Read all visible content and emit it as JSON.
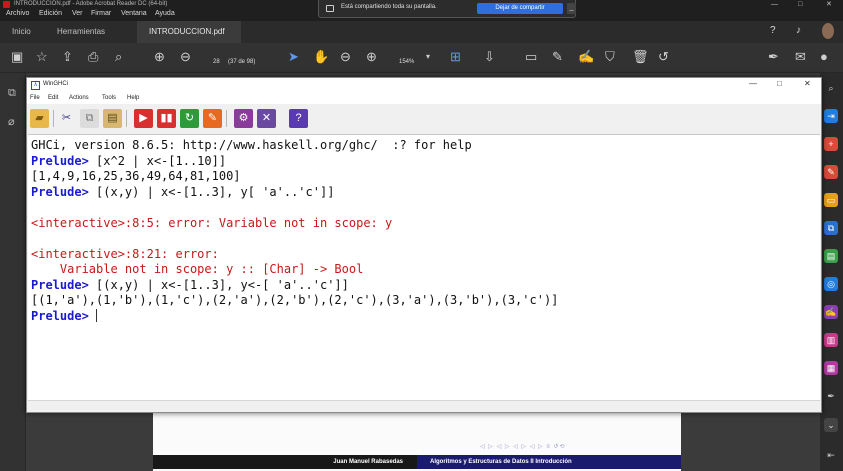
{
  "acrobat": {
    "title": "INTRODUCCION.pdf - Adobe Acrobat Reader DC (64-bit)",
    "window_controls": [
      "—",
      "□",
      "✕"
    ],
    "menu": [
      "Archivo",
      "Edición",
      "Ver",
      "Firmar",
      "Ventana",
      "Ayuda"
    ],
    "tabs": [
      "Inicio",
      "Herramientas",
      "INTRODUCCION.pdf ×"
    ],
    "page_current": "28",
    "page_total": "(37 de 98)",
    "zoom": "154%"
  },
  "share_banner": {
    "text": "Está compartiendo toda su pantalla.",
    "button": "Dejar de compartir",
    "minimize": "_"
  },
  "winghci": {
    "title": "WinGHCi",
    "controls": [
      "—",
      "□",
      "✕"
    ],
    "menu": [
      "File",
      "Edit",
      "Actions",
      "Tools",
      "Help"
    ],
    "console_lines": {
      "l1": "GHCi, version 8.6.5: http://www.haskell.org/ghc/  :? for help",
      "p2": "Prelude>",
      "c2": " [x^2 | x<-[1..10]]",
      "l3": "[1,4,9,16,25,36,49,64,81,100]",
      "p4": "Prelude>",
      "c4": " [(x,y) | x<-[1..3], y[ 'a'..'c']]",
      "l6": "<interactive>:8:5: error: Variable not in scope: y",
      "l8": "<interactive>:8:21: error:",
      "l9": "    Variable not in scope: y :: [Char] -> Bool",
      "p10": "Prelude>",
      "c10": " [(x,y) | x<-[1..3], y<-[ 'a'..'c']]",
      "l11": "[(1,'a'),(1,'b'),(1,'c'),(2,'a'),(2,'b'),(2,'c'),(3,'a'),(3,'b'),(3,'c')]",
      "p12": "Prelude>"
    }
  },
  "pdf": {
    "footer_author": "Juan Manuel Rabasedas",
    "footer_course": "Algoritmos y Estructuras de Datos II   Introducción"
  },
  "colors": {
    "prompt": "#1a1ad0",
    "error": "#c81818",
    "share_button": "#2e6fe0"
  }
}
